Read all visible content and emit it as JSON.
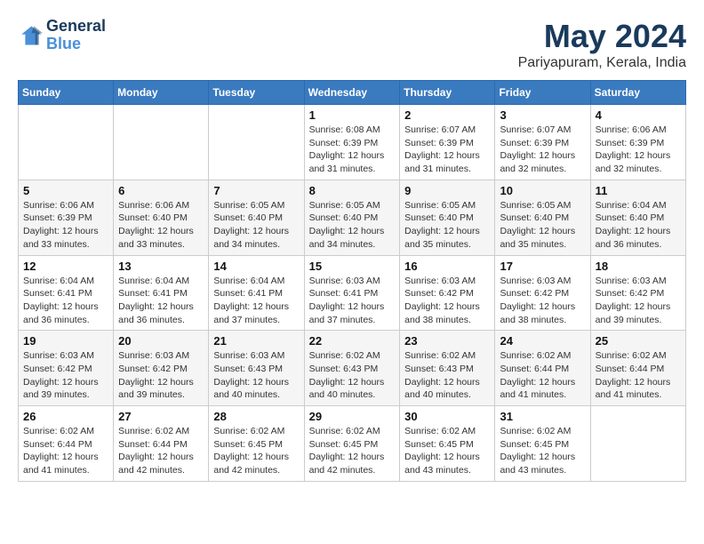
{
  "logo": {
    "line1": "General",
    "line2": "Blue"
  },
  "title": "May 2024",
  "subtitle": "Pariyapuram, Kerala, India",
  "days_header": [
    "Sunday",
    "Monday",
    "Tuesday",
    "Wednesday",
    "Thursday",
    "Friday",
    "Saturday"
  ],
  "weeks": [
    [
      {
        "day": "",
        "sunrise": "",
        "sunset": "",
        "daylight": ""
      },
      {
        "day": "",
        "sunrise": "",
        "sunset": "",
        "daylight": ""
      },
      {
        "day": "",
        "sunrise": "",
        "sunset": "",
        "daylight": ""
      },
      {
        "day": "1",
        "sunrise": "Sunrise: 6:08 AM",
        "sunset": "Sunset: 6:39 PM",
        "daylight": "Daylight: 12 hours and 31 minutes."
      },
      {
        "day": "2",
        "sunrise": "Sunrise: 6:07 AM",
        "sunset": "Sunset: 6:39 PM",
        "daylight": "Daylight: 12 hours and 31 minutes."
      },
      {
        "day": "3",
        "sunrise": "Sunrise: 6:07 AM",
        "sunset": "Sunset: 6:39 PM",
        "daylight": "Daylight: 12 hours and 32 minutes."
      },
      {
        "day": "4",
        "sunrise": "Sunrise: 6:06 AM",
        "sunset": "Sunset: 6:39 PM",
        "daylight": "Daylight: 12 hours and 32 minutes."
      }
    ],
    [
      {
        "day": "5",
        "sunrise": "Sunrise: 6:06 AM",
        "sunset": "Sunset: 6:39 PM",
        "daylight": "Daylight: 12 hours and 33 minutes."
      },
      {
        "day": "6",
        "sunrise": "Sunrise: 6:06 AM",
        "sunset": "Sunset: 6:40 PM",
        "daylight": "Daylight: 12 hours and 33 minutes."
      },
      {
        "day": "7",
        "sunrise": "Sunrise: 6:05 AM",
        "sunset": "Sunset: 6:40 PM",
        "daylight": "Daylight: 12 hours and 34 minutes."
      },
      {
        "day": "8",
        "sunrise": "Sunrise: 6:05 AM",
        "sunset": "Sunset: 6:40 PM",
        "daylight": "Daylight: 12 hours and 34 minutes."
      },
      {
        "day": "9",
        "sunrise": "Sunrise: 6:05 AM",
        "sunset": "Sunset: 6:40 PM",
        "daylight": "Daylight: 12 hours and 35 minutes."
      },
      {
        "day": "10",
        "sunrise": "Sunrise: 6:05 AM",
        "sunset": "Sunset: 6:40 PM",
        "daylight": "Daylight: 12 hours and 35 minutes."
      },
      {
        "day": "11",
        "sunrise": "Sunrise: 6:04 AM",
        "sunset": "Sunset: 6:40 PM",
        "daylight": "Daylight: 12 hours and 36 minutes."
      }
    ],
    [
      {
        "day": "12",
        "sunrise": "Sunrise: 6:04 AM",
        "sunset": "Sunset: 6:41 PM",
        "daylight": "Daylight: 12 hours and 36 minutes."
      },
      {
        "day": "13",
        "sunrise": "Sunrise: 6:04 AM",
        "sunset": "Sunset: 6:41 PM",
        "daylight": "Daylight: 12 hours and 36 minutes."
      },
      {
        "day": "14",
        "sunrise": "Sunrise: 6:04 AM",
        "sunset": "Sunset: 6:41 PM",
        "daylight": "Daylight: 12 hours and 37 minutes."
      },
      {
        "day": "15",
        "sunrise": "Sunrise: 6:03 AM",
        "sunset": "Sunset: 6:41 PM",
        "daylight": "Daylight: 12 hours and 37 minutes."
      },
      {
        "day": "16",
        "sunrise": "Sunrise: 6:03 AM",
        "sunset": "Sunset: 6:42 PM",
        "daylight": "Daylight: 12 hours and 38 minutes."
      },
      {
        "day": "17",
        "sunrise": "Sunrise: 6:03 AM",
        "sunset": "Sunset: 6:42 PM",
        "daylight": "Daylight: 12 hours and 38 minutes."
      },
      {
        "day": "18",
        "sunrise": "Sunrise: 6:03 AM",
        "sunset": "Sunset: 6:42 PM",
        "daylight": "Daylight: 12 hours and 39 minutes."
      }
    ],
    [
      {
        "day": "19",
        "sunrise": "Sunrise: 6:03 AM",
        "sunset": "Sunset: 6:42 PM",
        "daylight": "Daylight: 12 hours and 39 minutes."
      },
      {
        "day": "20",
        "sunrise": "Sunrise: 6:03 AM",
        "sunset": "Sunset: 6:42 PM",
        "daylight": "Daylight: 12 hours and 39 minutes."
      },
      {
        "day": "21",
        "sunrise": "Sunrise: 6:03 AM",
        "sunset": "Sunset: 6:43 PM",
        "daylight": "Daylight: 12 hours and 40 minutes."
      },
      {
        "day": "22",
        "sunrise": "Sunrise: 6:02 AM",
        "sunset": "Sunset: 6:43 PM",
        "daylight": "Daylight: 12 hours and 40 minutes."
      },
      {
        "day": "23",
        "sunrise": "Sunrise: 6:02 AM",
        "sunset": "Sunset: 6:43 PM",
        "daylight": "Daylight: 12 hours and 40 minutes."
      },
      {
        "day": "24",
        "sunrise": "Sunrise: 6:02 AM",
        "sunset": "Sunset: 6:44 PM",
        "daylight": "Daylight: 12 hours and 41 minutes."
      },
      {
        "day": "25",
        "sunrise": "Sunrise: 6:02 AM",
        "sunset": "Sunset: 6:44 PM",
        "daylight": "Daylight: 12 hours and 41 minutes."
      }
    ],
    [
      {
        "day": "26",
        "sunrise": "Sunrise: 6:02 AM",
        "sunset": "Sunset: 6:44 PM",
        "daylight": "Daylight: 12 hours and 41 minutes."
      },
      {
        "day": "27",
        "sunrise": "Sunrise: 6:02 AM",
        "sunset": "Sunset: 6:44 PM",
        "daylight": "Daylight: 12 hours and 42 minutes."
      },
      {
        "day": "28",
        "sunrise": "Sunrise: 6:02 AM",
        "sunset": "Sunset: 6:45 PM",
        "daylight": "Daylight: 12 hours and 42 minutes."
      },
      {
        "day": "29",
        "sunrise": "Sunrise: 6:02 AM",
        "sunset": "Sunset: 6:45 PM",
        "daylight": "Daylight: 12 hours and 42 minutes."
      },
      {
        "day": "30",
        "sunrise": "Sunrise: 6:02 AM",
        "sunset": "Sunset: 6:45 PM",
        "daylight": "Daylight: 12 hours and 43 minutes."
      },
      {
        "day": "31",
        "sunrise": "Sunrise: 6:02 AM",
        "sunset": "Sunset: 6:45 PM",
        "daylight": "Daylight: 12 hours and 43 minutes."
      },
      {
        "day": "",
        "sunrise": "",
        "sunset": "",
        "daylight": ""
      }
    ]
  ]
}
